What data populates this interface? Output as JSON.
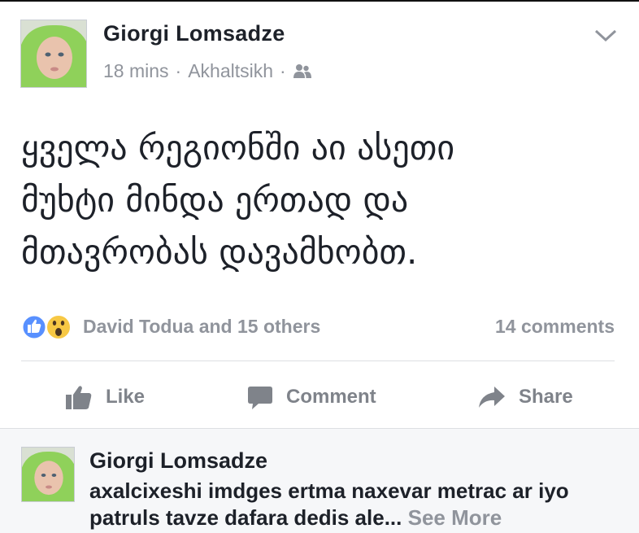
{
  "post": {
    "author": "Giorgi  Lomsadze",
    "time": "18 mins",
    "separator": "·",
    "location": "Akhaltsikh",
    "audience_icon": "friends-icon",
    "menu_icon": "chevron-down-icon",
    "text_lines": [
      "ყველა რეგიონში აი ასეთი",
      "მუხტი მინდა ერთად და",
      "მთავრობას დავამხობთ."
    ],
    "reactions": {
      "icons": [
        "like-reaction-icon",
        "wow-reaction-icon"
      ],
      "names": "David Todua and 15 others",
      "comments": "14 comments"
    },
    "actions": {
      "like": "Like",
      "comment": "Comment",
      "share": "Share"
    }
  },
  "comment": {
    "author": "Giorgi  Lomsadze",
    "text": "axalcixeshi imdges ertma naxevar metrac ar iyo patruls tavze dafara dedis ale...",
    "see_more": "See More"
  },
  "colors": {
    "text_primary": "#1d2129",
    "text_secondary": "#90949c",
    "like_blue": "#5890ff",
    "wow_yellow": "#f7c844"
  }
}
